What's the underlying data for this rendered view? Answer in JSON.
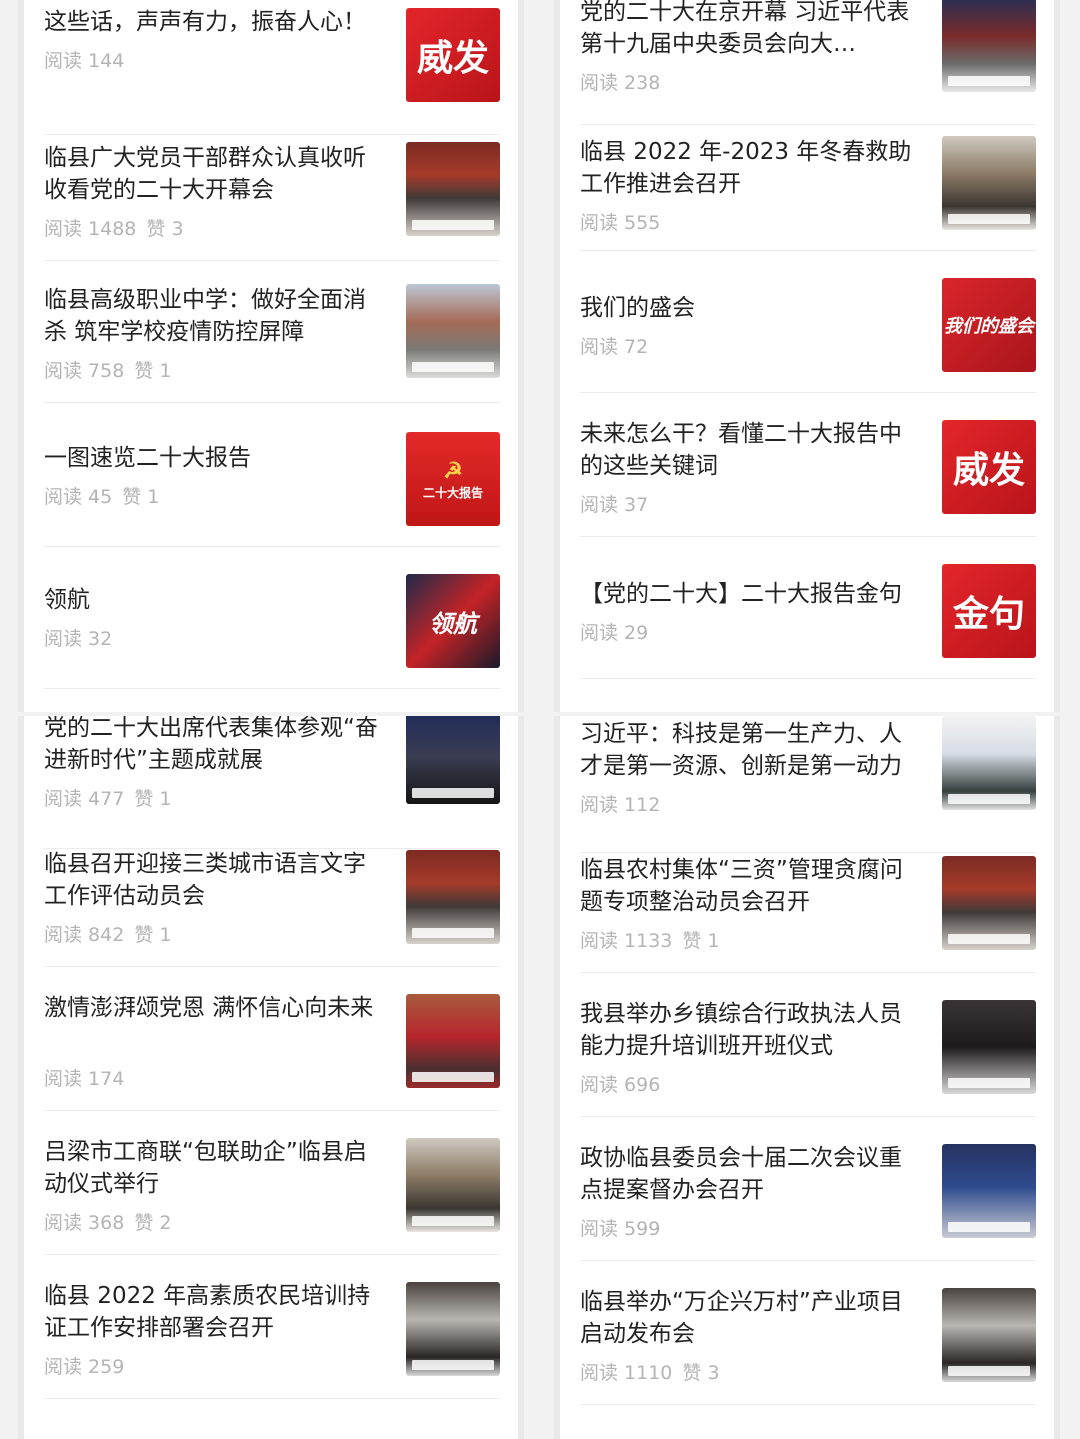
{
  "panels": {
    "top_left": [
      {
        "title": "这些话，声声有力，振奋人心！",
        "reads": "阅读 144",
        "likes": "",
        "thumb_text": "威发",
        "thumb_style": "red"
      },
      {
        "title": "临县广大党员干部群众认真收听收看党的二十大开幕会",
        "reads": "阅读 1488",
        "likes": "赞 3",
        "thumb_text": "",
        "thumb_style": "photo-hall"
      },
      {
        "title": "临县高级职业中学：做好全面消杀 筑牢学校疫情防控屏障",
        "reads": "阅读 758",
        "likes": "赞 1",
        "thumb_text": "",
        "thumb_style": "photo-outdoor"
      },
      {
        "title": "一图速览二十大报告",
        "reads": "阅读 45",
        "likes": "赞 1",
        "thumb_text": "二十大报告",
        "thumb_style": "party"
      },
      {
        "title": "领航",
        "reads": "阅读 32",
        "likes": "",
        "thumb_text": "领航",
        "thumb_style": "photo-ling"
      }
    ],
    "top_right": [
      {
        "title": "党的二十大在京开幕 习近平代表第十九届中央委员会向大…",
        "reads": "阅读 238",
        "likes": "",
        "thumb_text": "",
        "thumb_style": "photo-stage"
      },
      {
        "title": "临县 2022 年-2023 年冬春救助工作推进会召开",
        "reads": "阅读 555",
        "likes": "",
        "thumb_text": "",
        "thumb_style": "photo-room"
      },
      {
        "title": "我们的盛会",
        "reads": "阅读 72",
        "likes": "",
        "thumb_text": "我们的盛会",
        "thumb_style": "red-soft"
      },
      {
        "title": "未来怎么干？看懂二十大报告中的这些关键词",
        "reads": "阅读 37",
        "likes": "",
        "thumb_text": "威发",
        "thumb_style": "red"
      },
      {
        "title": "【党的二十大】二十大报告金句",
        "reads": "阅读 29",
        "likes": "",
        "thumb_text": "金句",
        "thumb_style": "red"
      }
    ],
    "bottom_left": [
      {
        "title": "党的二十大出席代表集体参观“奋进新时代”主题成就展",
        "reads": "阅读 477",
        "likes": "赞 1",
        "thumb_text": "",
        "thumb_style": "photo-blue"
      },
      {
        "title": "临县召开迎接三类城市语言文字工作评估动员会",
        "reads": "阅读 842",
        "likes": "赞 1",
        "thumb_text": "",
        "thumb_style": "photo-hall"
      },
      {
        "title": "激情澎湃颂党恩 满怀信心向未来",
        "reads": "阅读 174",
        "likes": "",
        "thumb_text": "",
        "thumb_style": "photo-crowd"
      },
      {
        "title": "吕梁市工商联“包联助企”临县启动仪式举行",
        "reads": "阅读 368",
        "likes": "赞 2",
        "thumb_text": "",
        "thumb_style": "photo-room"
      },
      {
        "title": "临县 2022 年高素质农民培训持证工作安排部署会召开",
        "reads": "阅读 259",
        "likes": "",
        "thumb_text": "",
        "thumb_style": "photo-proj"
      }
    ],
    "bottom_right": [
      {
        "title": "习近平：科技是第一生产力、人才是第一资源、创新是第一动力",
        "reads": "阅读 112",
        "likes": "",
        "thumb_text": "",
        "thumb_style": "photo-tech"
      },
      {
        "title": "临县农村集体“三资”管理贪腐问题专项整治动员会召开",
        "reads": "阅读 1133",
        "likes": "赞 1",
        "thumb_text": "",
        "thumb_style": "photo-hall"
      },
      {
        "title": "我县举办乡镇综合行政执法人员能力提升培训班开班仪式",
        "reads": "阅读 696",
        "likes": "",
        "thumb_text": "",
        "thumb_style": "photo-dark"
      },
      {
        "title": "政协临县委员会十届二次会议重点提案督办会召开",
        "reads": "阅读 599",
        "likes": "",
        "thumb_text": "",
        "thumb_style": "photo-navy"
      },
      {
        "title": "临县举办“万企兴万村”产业项目启动发布会",
        "reads": "阅读 1110",
        "likes": "赞 3",
        "thumb_text": "",
        "thumb_style": "photo-proj"
      }
    ]
  }
}
